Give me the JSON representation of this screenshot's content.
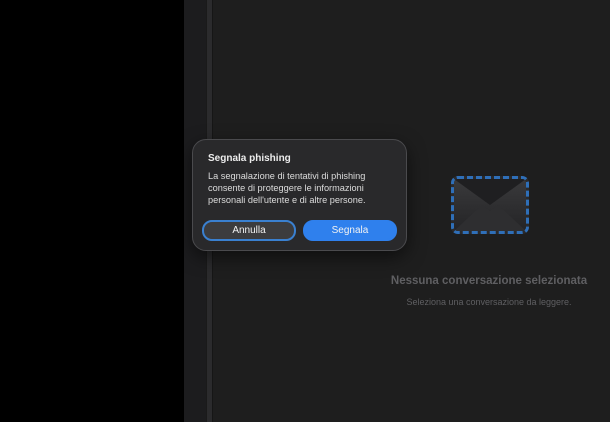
{
  "dialog": {
    "title": "Segnala phishing",
    "message_lines": [
      "La segnalazione di tentativi di phishing",
      "consente di proteggere le informazioni",
      "personali dell'utente e di altre persone."
    ],
    "cancel_label": "Annulla",
    "confirm_label": "Segnala"
  },
  "empty_state": {
    "icon": "envelope-icon",
    "title": "Nessuna conversazione selezionata",
    "subtitle": "Seleziona una conversazione da leggere."
  },
  "colors": {
    "accent": "#2f80ed",
    "focus_ring": "#3a80d0",
    "dialog_bg": "#29292b",
    "pane_bg": "#1e1e1e"
  }
}
